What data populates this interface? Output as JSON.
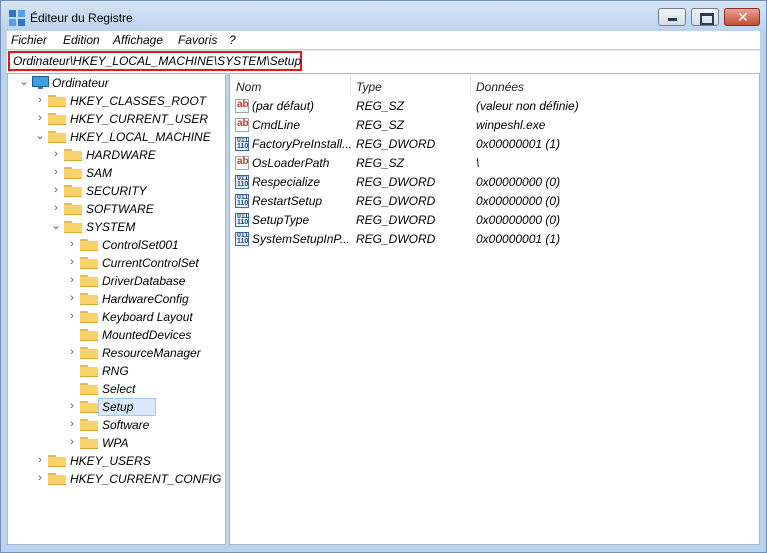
{
  "window": {
    "title": "Éditeur du Registre",
    "close_glyph": "✕"
  },
  "menu": [
    "Fichier",
    "Edition",
    "Affichage",
    "Favoris",
    "?"
  ],
  "address": "Ordinateur\\HKEY_LOCAL_MACHINE\\SYSTEM\\Setup",
  "tree": [
    {
      "label": "Ordinateur",
      "level": 0,
      "chevron": "⌄",
      "icon": "computer-icon"
    },
    {
      "label": "HKEY_CLASSES_ROOT",
      "level": 1,
      "chevron": "›"
    },
    {
      "label": "HKEY_CURRENT_USER",
      "level": 1,
      "chevron": "›"
    },
    {
      "label": "HKEY_LOCAL_MACHINE",
      "level": 1,
      "chevron": "⌄"
    },
    {
      "label": "HARDWARE",
      "level": 2,
      "chevron": "›"
    },
    {
      "label": "SAM",
      "level": 2,
      "chevron": "›"
    },
    {
      "label": "SECURITY",
      "level": 2,
      "chevron": "›"
    },
    {
      "label": "SOFTWARE",
      "level": 2,
      "chevron": "›"
    },
    {
      "label": "SYSTEM",
      "level": 2,
      "chevron": "⌄"
    },
    {
      "label": "ControlSet001",
      "level": 3,
      "chevron": "›"
    },
    {
      "label": "CurrentControlSet",
      "level": 3,
      "chevron": "›"
    },
    {
      "label": "DriverDatabase",
      "level": 3,
      "chevron": "›"
    },
    {
      "label": "HardwareConfig",
      "level": 3,
      "chevron": "›"
    },
    {
      "label": "Keyboard Layout",
      "level": 3,
      "chevron": "›"
    },
    {
      "label": "MountedDevices",
      "level": 3,
      "chevron": ""
    },
    {
      "label": "ResourceManager",
      "level": 3,
      "chevron": "›"
    },
    {
      "label": "RNG",
      "level": 3,
      "chevron": ""
    },
    {
      "label": "Select",
      "level": 3,
      "chevron": ""
    },
    {
      "label": "Setup",
      "level": 3,
      "chevron": "›",
      "selected": true
    },
    {
      "label": "Software",
      "level": 3,
      "chevron": "›"
    },
    {
      "label": "WPA",
      "level": 3,
      "chevron": "›"
    },
    {
      "label": "HKEY_USERS",
      "level": 1,
      "chevron": "›"
    },
    {
      "label": "HKEY_CURRENT_CONFIG",
      "level": 1,
      "chevron": "›"
    }
  ],
  "columns": [
    "Nom",
    "Type",
    "Données"
  ],
  "values": [
    {
      "name": "(par défaut)",
      "type": "REG_SZ",
      "data": "(valeur non définie)",
      "kind": "sz"
    },
    {
      "name": "CmdLine",
      "type": "REG_SZ",
      "data": "winpeshl.exe",
      "kind": "sz"
    },
    {
      "name": "FactoryPreInstall...",
      "type": "REG_DWORD",
      "data": "0x00000001 (1)",
      "kind": "dw"
    },
    {
      "name": "OsLoaderPath",
      "type": "REG_SZ",
      "data": "\\",
      "kind": "sz"
    },
    {
      "name": "Respecialize",
      "type": "REG_DWORD",
      "data": "0x00000000 (0)",
      "kind": "dw"
    },
    {
      "name": "RestartSetup",
      "type": "REG_DWORD",
      "data": "0x00000000 (0)",
      "kind": "dw"
    },
    {
      "name": "SetupType",
      "type": "REG_DWORD",
      "data": "0x00000000 (0)",
      "kind": "dw"
    },
    {
      "name": "SystemSetupInP...",
      "type": "REG_DWORD",
      "data": "0x00000001 (1)",
      "kind": "dw"
    }
  ],
  "icons": {
    "sz": "ab",
    "dw": "011\n110"
  },
  "colors": {
    "highlight_border": "#e01a1a",
    "selection": "#d9e8fb",
    "folder": "#f8d26a"
  }
}
